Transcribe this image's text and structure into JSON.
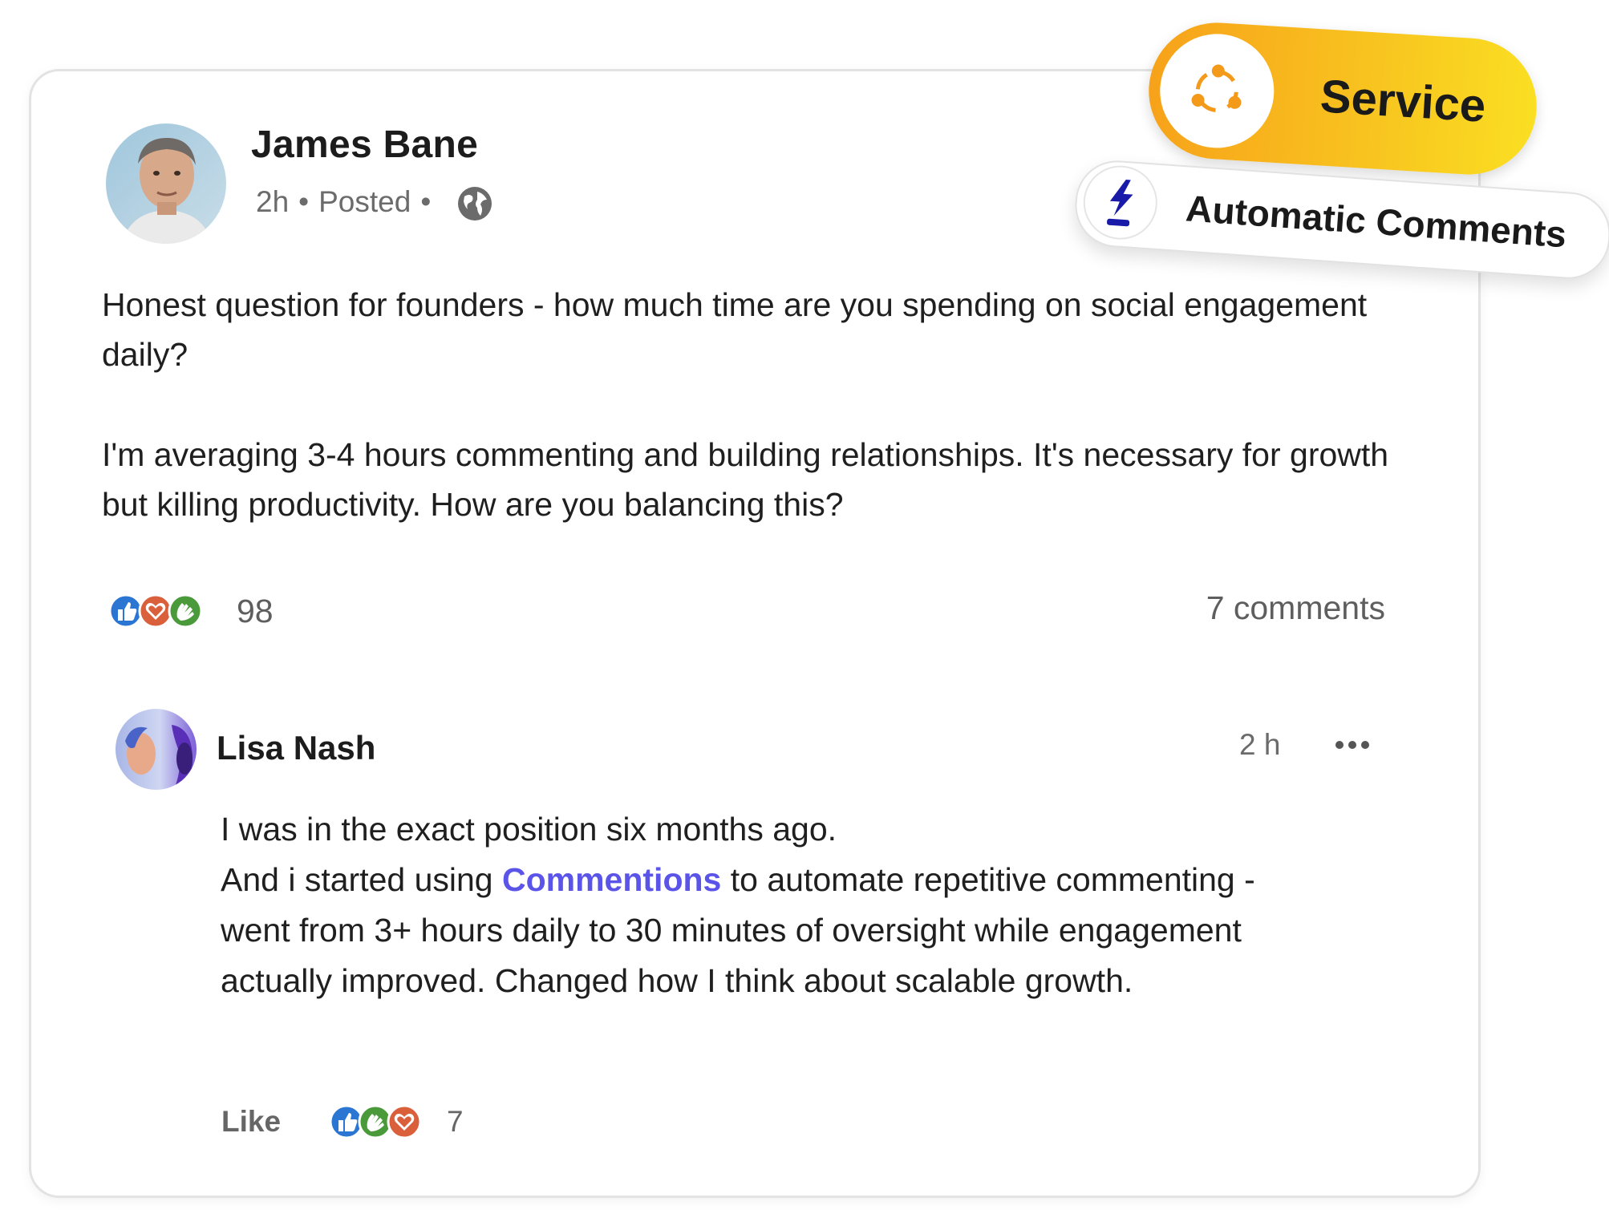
{
  "post": {
    "author": "James Bane",
    "time": "2h",
    "status": "Posted",
    "paragraphs": [
      "Honest question for founders - how much time are you spending on social engagement daily?",
      "I'm averaging 3-4 hours commenting and building relationships. It's necessary for growth but killing productivity. How are you balancing this?"
    ],
    "reaction_count": "98",
    "comments_count": "7 comments",
    "reaction_icons": [
      "like-icon",
      "love-icon",
      "celebrate-icon"
    ],
    "visibility_icon": "globe-icon"
  },
  "comment": {
    "author": "Lisa Nash",
    "time": "2 h",
    "more_icon": "more-horizontal-icon",
    "line1": "I was in the exact position six months ago.",
    "line2_before": "And i started using ",
    "line2_link": "Commentions",
    "line2_after": " to automate repetitive commenting - went from 3+ hours daily to 30 minutes of oversight while engagement actually improved. Changed how I think about scalable growth.",
    "like_label": "Like",
    "reaction_count": "7",
    "reaction_icons": [
      "like-icon",
      "celebrate-icon",
      "love-icon"
    ]
  },
  "badges": {
    "service_label": "Service",
    "service_icon": "share-nodes-icon",
    "automatic_label": "Automatic Comments",
    "automatic_icon": "lightning-icon"
  },
  "colors": {
    "link": "#5b54e8",
    "service_gradient_start": "#f7a21a",
    "service_gradient_end": "#fadf22",
    "service_icon": "#f49a1a",
    "lightning": "#1a1aa8",
    "like": "#2b76d2",
    "love": "#d9603b",
    "celebrate": "#4a9a3c"
  }
}
